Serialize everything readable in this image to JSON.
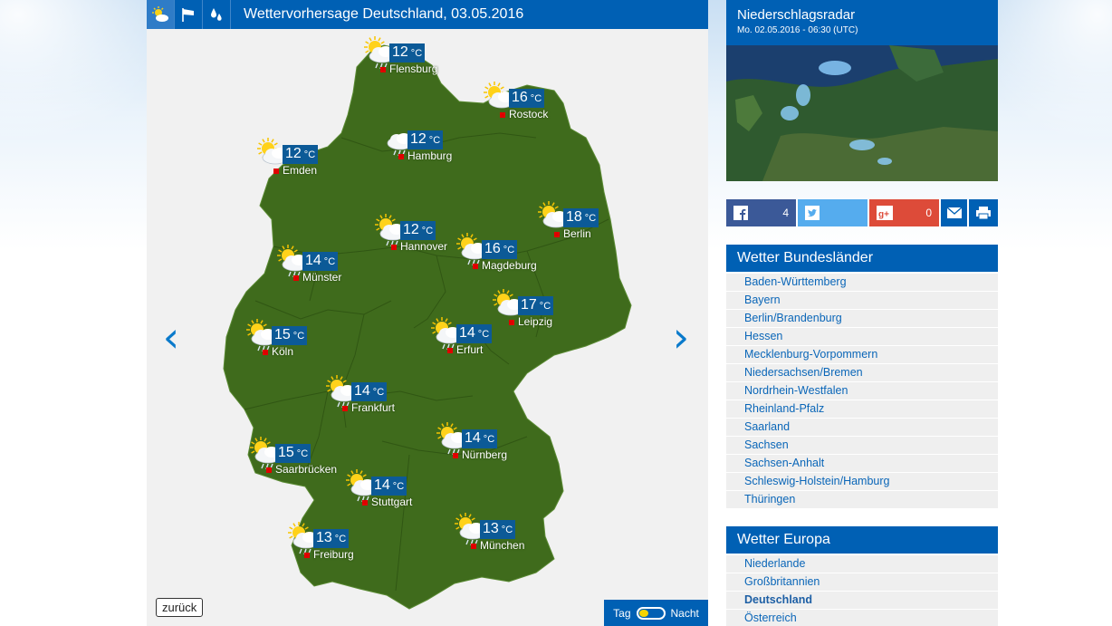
{
  "map": {
    "title": "Wettervorhersage Deutschland, 03.05.2016",
    "back_label": "zurück",
    "day_label": "Tag",
    "night_label": "Nacht",
    "prev_arrow": "‹",
    "next_arrow": "›",
    "cities": [
      {
        "name": "Flensburg",
        "temp": "12",
        "icon": "sun-cloud-rain-icon"
      },
      {
        "name": "Rostock",
        "temp": "16",
        "icon": "sun-cloud-icon"
      },
      {
        "name": "Emden",
        "temp": "12",
        "icon": "sun-cloud-icon"
      },
      {
        "name": "Hamburg",
        "temp": "12",
        "icon": "cloud-rain-icon"
      },
      {
        "name": "Berlin",
        "temp": "18",
        "icon": "sun-cloud-icon"
      },
      {
        "name": "Hannover",
        "temp": "12",
        "icon": "sun-cloud-rain-icon"
      },
      {
        "name": "Magdeburg",
        "temp": "16",
        "icon": "sun-cloud-rain-icon"
      },
      {
        "name": "Münster",
        "temp": "14",
        "icon": "sun-cloud-rain-icon"
      },
      {
        "name": "Leipzig",
        "temp": "17",
        "icon": "sun-cloud-icon"
      },
      {
        "name": "Köln",
        "temp": "15",
        "icon": "sun-cloud-rain-icon"
      },
      {
        "name": "Erfurt",
        "temp": "14",
        "icon": "sun-cloud-rain-icon"
      },
      {
        "name": "Frankfurt",
        "temp": "14",
        "icon": "sun-cloud-rain-icon"
      },
      {
        "name": "Saarbrücken",
        "temp": "15",
        "icon": "sun-cloud-rain-icon"
      },
      {
        "name": "Nürnberg",
        "temp": "14",
        "icon": "sun-cloud-rain-icon"
      },
      {
        "name": "Stuttgart",
        "temp": "14",
        "icon": "sun-cloud-rain-icon"
      },
      {
        "name": "Freiburg",
        "temp": "13",
        "icon": "sun-cloud-rain-icon"
      },
      {
        "name": "München",
        "temp": "13",
        "icon": "sun-cloud-rain-icon"
      }
    ],
    "unit": "°C"
  },
  "radar": {
    "title": "Niederschlagsradar",
    "subtitle": "Mo. 02.05.2016 - 06:30 (UTC)"
  },
  "share": {
    "facebook_count": "4",
    "googleplus_count": "0"
  },
  "bundeslaender": {
    "title": "Wetter Bundesländer",
    "items": [
      "Baden-Württemberg",
      "Bayern",
      "Berlin/Brandenburg",
      "Hessen",
      "Mecklenburg-Vorpommern",
      "Niedersachsen/Bremen",
      "Nordrhein-Westfalen",
      "Rheinland-Pfalz",
      "Saarland",
      "Sachsen",
      "Sachsen-Anhalt",
      "Schleswig-Holstein/Hamburg",
      "Thüringen"
    ]
  },
  "europa": {
    "title": "Wetter Europa",
    "items": [
      "Niederlande",
      "Großbritannien",
      "Deutschland",
      "Österreich"
    ]
  },
  "colors": {
    "brand_blue": "#0060b4",
    "map_green": "#3e6b1b",
    "temp_badge": "#0c5a97",
    "city_dot": "#e00000"
  }
}
